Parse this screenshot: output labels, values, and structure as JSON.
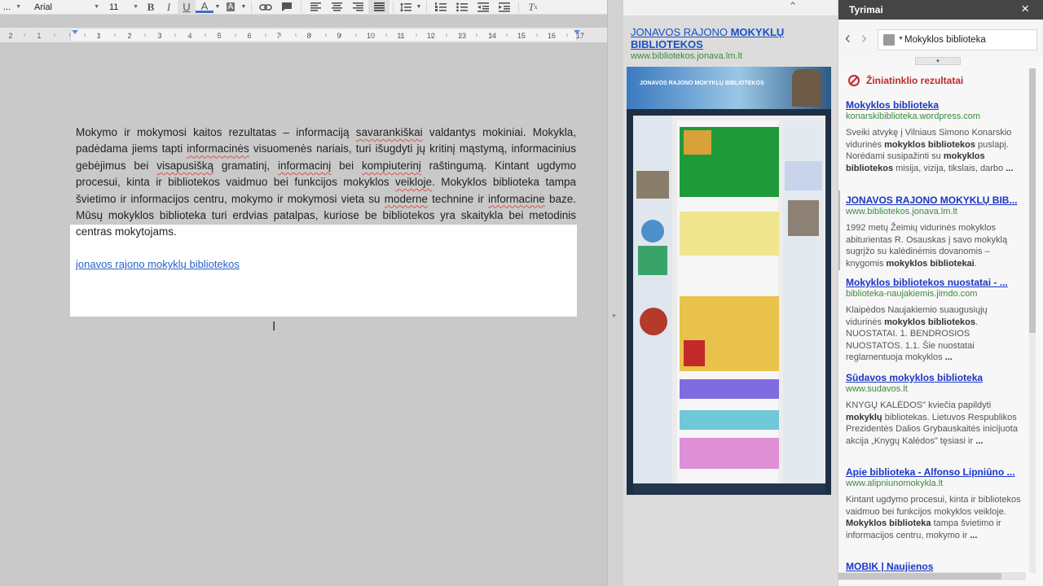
{
  "toolbar": {
    "style_dd": "...",
    "font": "Arial",
    "size": "11",
    "bold": "B",
    "italic": "I",
    "underline": "U",
    "text_color": "A",
    "highlight": "A"
  },
  "ruler": {
    "numbers": [
      "2",
      "1",
      "1",
      "2",
      "3",
      "4",
      "5",
      "6",
      "7",
      "8",
      "9",
      "10",
      "11",
      "12",
      "13",
      "14",
      "15",
      "16",
      "17"
    ]
  },
  "document": {
    "paragraph_parts": [
      "Mokymo ir mokymosi kaitos rezultatas – informaciją ",
      "savarankiškai",
      " valdantys mokiniai. Mokykla, padėdama jiems tapti ",
      "informacinės",
      " visuomenės nariais, turi išugdyti jų kritinį mąstymą, informacinius gebėjimus bei ",
      "visapusišką",
      " gramatinį, ",
      "informacinį",
      " bei ",
      "kompiuterinį",
      " raštingumą. Kintant ugdymo procesui, kinta ir bibliotekos vaidmuo bei funkcijos mokyklos ",
      "veikloje",
      ". Mokyklos biblioteka tampa švietimo ir informacijos centru, mokymo ir mokymosi vieta su ",
      "moderne",
      " technine ir ",
      "informacine",
      " baze. Mūsų mokyklos biblioteka turi erdvias patalpas, kuriose be bibliotekos yra skaitykla bei metodinis centras mokytojams."
    ],
    "link_text": "jonavos rajono mokyklų bibliotekos"
  },
  "preview": {
    "title_normal": "JONAVOS RAJONO ",
    "title_bold": "MOKYKLŲ BIBLIOTEKOS",
    "url": "www.bibliotekos.jonava.lm.lt",
    "banner_text": "JONAVOS RAJONO MOKYKLŲ BIBLIOTEKOS"
  },
  "research": {
    "title": "Tyrimai",
    "close": "×",
    "back": "‹",
    "forward": "›",
    "search_query": "Mokyklos biblioteka",
    "dropdown": "▾",
    "results_header": "Žiniatinklio rezultatai",
    "results": [
      {
        "title": "Mokyklos biblioteka",
        "url": "konarskibiblioteka.wordpress.com",
        "snippet": "Sveiki atvykę į Vilniaus Simono Konarskio vidurinės <b>mokyklos bibliotekos</b> puslapį. Norėdami susipažinti su <b>mokyklos bibliotekos</b> misija, vizija, tikslais, darbo <b>...</b>"
      },
      {
        "title": "JONAVOS RAJONO MOKYKLŲ BIB...",
        "url": "www.bibliotekos.jonava.lm.lt",
        "snippet": "1992 metų Žeimių vidurinės mokyklos abiturientas R. Osauskas į savo mokyklą sugrįžo su kalėdinėmis dovanomis – knygomis <b>mokyklos bibliotekai</b>."
      },
      {
        "title": "Mokyklos bibliotekos nuostatai - ...",
        "url": "biblioteka-naujakiemis.jimdo.com",
        "snippet": "Klaipėdos Naujakiemio suaugusiųjų vidurinės <b>mokyklos bibliotekos</b>. NUOSTATAI. 1. BENDROSIOS NUOSTATOS. 1.1. Šie nuostatai reglamentuoja mokyklos <b>...</b>"
      },
      {
        "title": "Sūdavos mokyklos biblioteka",
        "url": "www.sudavos.lt",
        "snippet": "KNYGŲ KALĖDOS\" kviečia papildyti <b>mokyklų</b> bibliotekas. Lietuvos Respublikos Prezidentės Dalios Grybauskaitės inicijuota akcija „Knygų Kalėdos\" tęsiasi ir <b>...</b>"
      },
      {
        "title": "Apie biblioteka - Alfonso Lipniūno ...",
        "url": "www.alipniunomokykla.lt",
        "snippet": "Kintant ugdymo procesui, kinta ir bibliotekos vaidmuo bei funkcijos mokyklos veikloje. <b>Mokyklos biblioteka</b> tampa švietimo ir informacijos centru, mokymo ir <b>...</b>"
      },
      {
        "title": "MOBIK | Naujienos",
        "url": "",
        "snippet": ""
      }
    ]
  },
  "colors": {
    "link_blue": "#1a36c7",
    "url_green": "#3d8a3d",
    "header_dark": "#454545",
    "no_icon_red": "#c1272d"
  }
}
